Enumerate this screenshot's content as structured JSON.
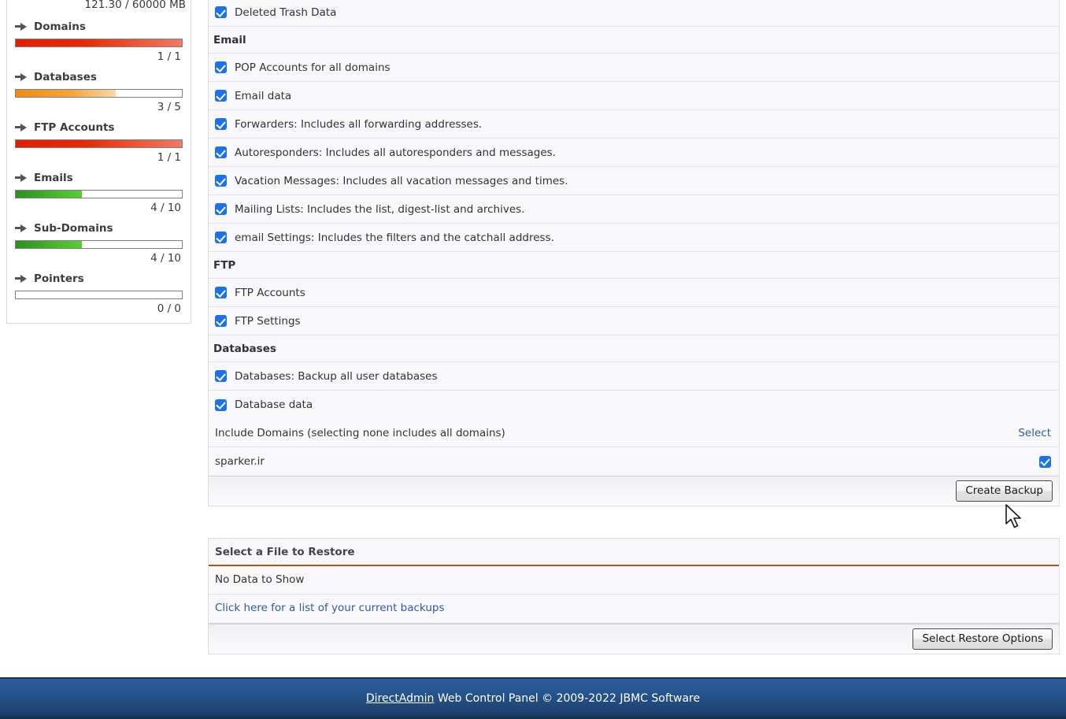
{
  "sidebar": {
    "disk_usage": "121.30 / 60000 MB",
    "stats": [
      {
        "label": "Domains",
        "value": "1 / 1",
        "percent": 100,
        "color": "red"
      },
      {
        "label": "Databases",
        "value": "3 / 5",
        "percent": 60,
        "color": "orange"
      },
      {
        "label": "FTP Accounts",
        "value": "1 / 1",
        "percent": 100,
        "color": "red"
      },
      {
        "label": "Emails",
        "value": "4 / 10",
        "percent": 40,
        "color": "green"
      },
      {
        "label": "Sub-Domains",
        "value": "4 / 10",
        "percent": 40,
        "color": "green"
      },
      {
        "label": "Pointers",
        "value": "0 / 0",
        "percent": 0,
        "color": "green"
      }
    ]
  },
  "backup": {
    "rows": [
      {
        "type": "option",
        "label": "Deleted Trash Data",
        "checked": true
      },
      {
        "type": "section",
        "label": "Email"
      },
      {
        "type": "option",
        "label": "POP Accounts for all domains",
        "checked": true
      },
      {
        "type": "option",
        "label": "Email data",
        "checked": true
      },
      {
        "type": "option",
        "label": "Forwarders: Includes all forwarding addresses.",
        "checked": true
      },
      {
        "type": "option",
        "label": "Autoresponders: Includes all autoresponders and messages.",
        "checked": true
      },
      {
        "type": "option",
        "label": "Vacation Messages: Includes all vacation messages and times.",
        "checked": true
      },
      {
        "type": "option",
        "label": "Mailing Lists: Includes the list, digest-list and archives.",
        "checked": true
      },
      {
        "type": "option",
        "label": "email Settings: Includes the filters and the catchall address.",
        "checked": true
      },
      {
        "type": "section",
        "label": "FTP"
      },
      {
        "type": "option",
        "label": "FTP Accounts",
        "checked": true
      },
      {
        "type": "option",
        "label": "FTP Settings",
        "checked": true
      },
      {
        "type": "section",
        "label": "Databases"
      },
      {
        "type": "option",
        "label": "Databases: Backup all user databases",
        "checked": true
      },
      {
        "type": "option",
        "label": "Database data",
        "checked": true
      }
    ],
    "include_domains_label": "Include Domains (selecting none includes all domains)",
    "select_link": "Select",
    "domains": [
      {
        "name": "sparker.ir",
        "checked": true
      }
    ],
    "create_button": "Create Backup"
  },
  "restore": {
    "title": "Select a File to Restore",
    "no_data": "No Data to Show",
    "backups_link": "Click here for a list of your current backups",
    "options_button": "Select Restore Options"
  },
  "footer": {
    "brand": "DirectAdmin",
    "text": " Web Control Panel © 2009-2022 JBMC Software"
  },
  "colors": {
    "accent_blue": "#1a73e8",
    "link_blue": "#2e5d9e",
    "title_underline": "#b3541e",
    "footer_blue": "#26538b"
  }
}
